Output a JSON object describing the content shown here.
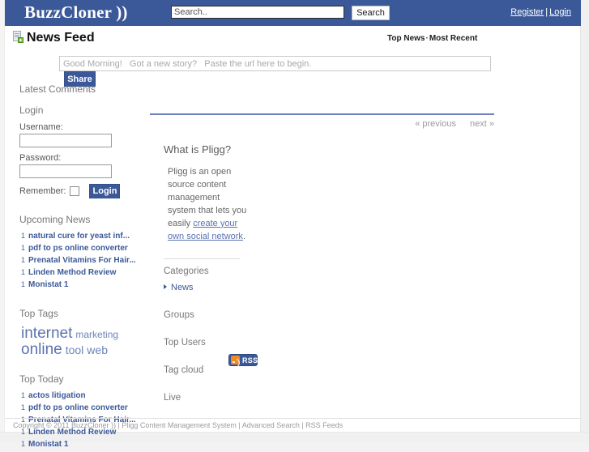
{
  "header": {
    "brand": "BuzzCloner ))",
    "search": {
      "value": "Search..",
      "placeholder": "Search..",
      "button_label": "Search"
    },
    "links": {
      "register": "Register",
      "separator": "|",
      "login": "Login"
    }
  },
  "feed": {
    "title": "News Feed",
    "sort": {
      "top_news": "Top News",
      "dot": "·",
      "most_recent": "Most Recent"
    },
    "share": {
      "placeholder": "Good Morning!   Got a new story?   Paste the url here to begin.",
      "button_label": "Share"
    }
  },
  "sidebar": {
    "latest_comments_heading": "Latest Comments",
    "login": {
      "heading": "Login",
      "username_label": "Username:",
      "password_label": "Password:",
      "remember_label": "Remember:",
      "button_label": "Login"
    },
    "upcoming_news": {
      "heading": "Upcoming News",
      "items": [
        {
          "count": "1",
          "title": "natural cure for yeast inf..."
        },
        {
          "count": "1",
          "title": "pdf to ps online converter"
        },
        {
          "count": "1",
          "title": "Prenatal Vitamins For Hair..."
        },
        {
          "count": "1",
          "title": "Linden Method Review"
        },
        {
          "count": "1",
          "title": "Monistat 1"
        }
      ]
    },
    "top_tags": {
      "heading": "Top Tags",
      "tags": [
        {
          "label": "internet",
          "size": "xl"
        },
        {
          "label": "marketing",
          "size": "md"
        },
        {
          "label": "online",
          "size": "xl"
        },
        {
          "label": "tool",
          "size": "lg"
        },
        {
          "label": "web",
          "size": "lg"
        }
      ]
    },
    "top_today": {
      "heading": "Top Today",
      "items": [
        {
          "count": "1",
          "title": "actos litigation"
        },
        {
          "count": "1",
          "title": "pdf to ps online converter"
        },
        {
          "count": "1",
          "title": "Prenatal Vitamins For Hair..."
        },
        {
          "count": "1",
          "title": "Linden Method Review"
        },
        {
          "count": "1",
          "title": "Monistat 1"
        }
      ]
    }
  },
  "main": {
    "pager": {
      "previous": "« previous",
      "next": "next »"
    },
    "about": {
      "heading": "What is Pligg?",
      "text_before": "Pligg is an open source content management system that lets you easily ",
      "link_text": "create your own social network",
      "text_after": "."
    },
    "categories": {
      "heading": "Categories",
      "items": [
        {
          "label": "News"
        }
      ]
    },
    "menu": [
      {
        "label": "Groups"
      },
      {
        "label": "Top Users"
      },
      {
        "label": "Tag cloud"
      },
      {
        "label": "Live"
      }
    ],
    "rss_label": "RSS"
  },
  "footer": {
    "text": "Copyright © 2011 BuzzCloner )) | Pligg Content Management System | Advanced Search | RSS Feeds"
  },
  "colors": {
    "brand_blue": "#3b5998",
    "link_blue": "#5b73b0",
    "rss_orange": "#f08a24",
    "muted_text": "#777777"
  }
}
